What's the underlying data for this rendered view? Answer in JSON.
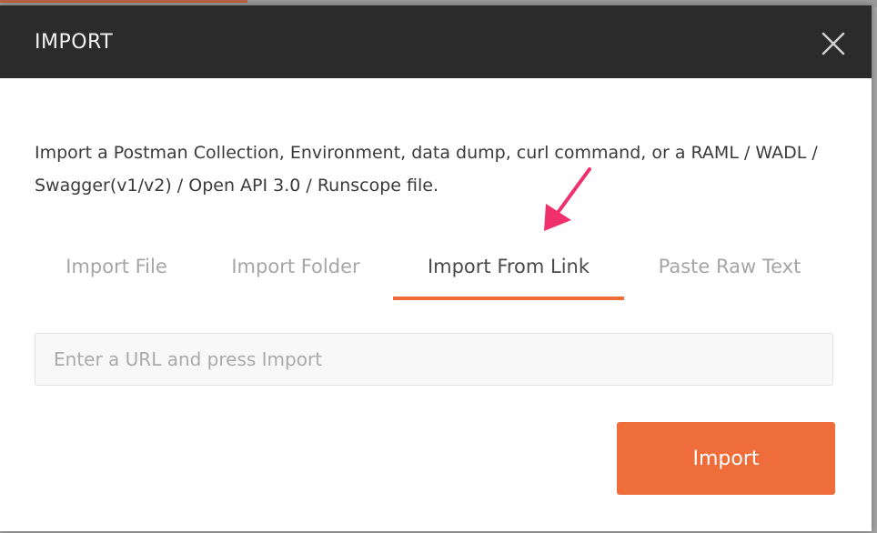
{
  "modal": {
    "title": "IMPORT",
    "close_icon": "close-icon",
    "description": "Import a Postman Collection, Environment, data dump, curl command, or a RAML / WADL / Swagger(v1/v2) / Open API 3.0 / Runscope file."
  },
  "tabs": [
    {
      "label": "Import File",
      "active": false
    },
    {
      "label": "Import Folder",
      "active": false
    },
    {
      "label": "Import From Link",
      "active": true
    },
    {
      "label": "Paste Raw Text",
      "active": false
    }
  ],
  "url_input": {
    "value": "",
    "placeholder": "Enter a URL and press Import"
  },
  "import_button": {
    "label": "Import"
  },
  "annotation": {
    "arrow_icon": "annotation-arrow-icon",
    "arrow_color": "#f0306c"
  },
  "colors": {
    "header_bg": "#2b2b2b",
    "accent": "#ef6c3b",
    "active_tab_underline": "#ee6b3a"
  }
}
